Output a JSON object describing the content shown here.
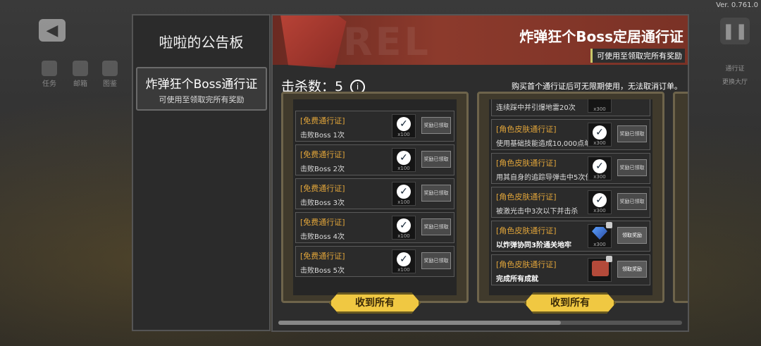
{
  "version": "Ver. 0.761.0",
  "hud": {
    "back_label": "◀",
    "items": [
      {
        "label": "任务"
      },
      {
        "label": "邮箱"
      },
      {
        "label": "图鉴"
      }
    ],
    "right_label": "通行证",
    "change_hall": "更换大厅"
  },
  "sidebar": {
    "title": "啦啦的公告板",
    "active_tab": {
      "title": "炸弹狂个Boss通行证",
      "subtitle": "可使用至领取完所有奖励"
    }
  },
  "banner": {
    "watermark": "REL",
    "title": "炸弹狂个Boss定居通行证",
    "subtitle": "可使用至领取完所有奖励"
  },
  "kills": {
    "label": "击杀数：5"
  },
  "notice": "购买首个通行证后可无限期使用，无法取消订单。",
  "free_pass": {
    "rows": [
      {
        "tag": "[免费通行证]",
        "desc": "击败Boss 1次",
        "qty": "x100",
        "claim": "奖励已领取"
      },
      {
        "tag": "[免费通行证]",
        "desc": "击败Boss 2次",
        "qty": "x100",
        "claim": "奖励已领取"
      },
      {
        "tag": "[免费通行证]",
        "desc": "击败Boss 3次",
        "qty": "x100",
        "claim": "奖励已领取"
      },
      {
        "tag": "[免费通行证]",
        "desc": "击败Boss 4次",
        "qty": "x100",
        "claim": "奖励已领取"
      },
      {
        "tag": "[免费通行证]",
        "desc": "击败Boss 5次",
        "qty": "x100",
        "claim": "奖励已领取"
      }
    ],
    "collect_all": "收到所有"
  },
  "skin_pass": {
    "top_partial": {
      "desc": "连续踩中并引爆地雷20次",
      "qty": "x300"
    },
    "rows": [
      {
        "tag": "[角色皮肤通行证]",
        "desc": "使用基础技能造成10,000点单",
        "qty": "x300",
        "claim": "奖励已领取"
      },
      {
        "tag": "[角色皮肤通行证]",
        "desc": "用其自身的追踪导弹击中5次使",
        "qty": "x300",
        "claim": "奖励已领取"
      },
      {
        "tag": "[角色皮肤通行证]",
        "desc": "被激光击中3次以下并击杀",
        "qty": "x300",
        "claim": "奖励已领取"
      },
      {
        "tag": "[角色皮肤通行证]",
        "desc": "以炸弹协同3阶通关地牢",
        "qty": "x300",
        "claim": "领取奖励"
      },
      {
        "tag": "[角色皮肤通行证]",
        "desc": "完成所有成就",
        "qty": "",
        "claim": "领取奖励"
      }
    ],
    "collect_all": "收到所有"
  }
}
